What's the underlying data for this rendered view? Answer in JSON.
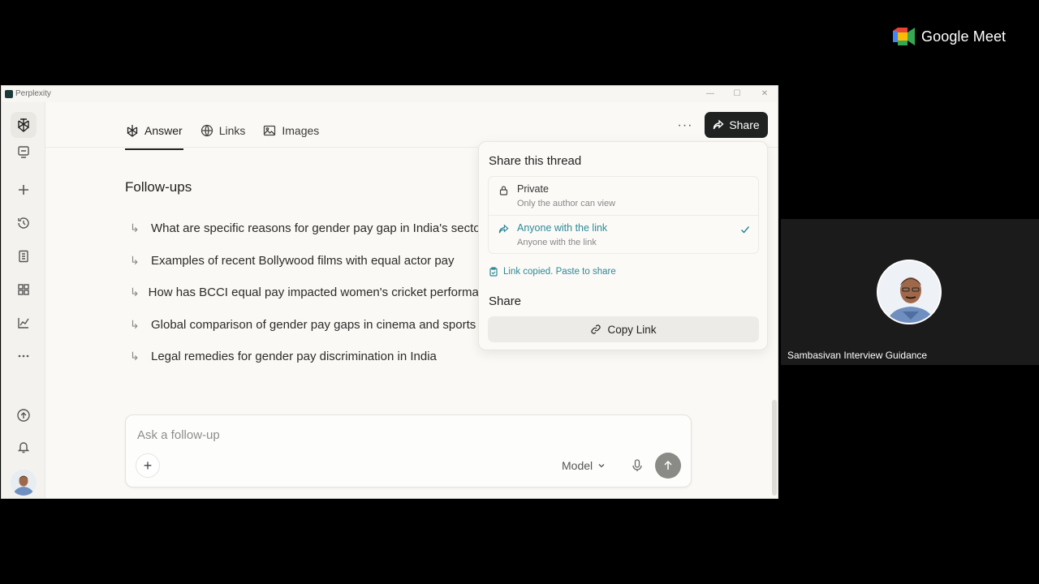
{
  "meet": {
    "brand": "Google Meet",
    "participant_name": "Sambasivan Interview Guidance",
    "colors": {
      "tile_bg": "#1b1b1b",
      "text": "#ffffff"
    }
  },
  "window": {
    "title": "Perplexity",
    "controls": [
      "minimize-icon",
      "maximize-icon",
      "close-icon"
    ]
  },
  "sidebar": {
    "items": [
      {
        "name": "perplexity-logo-icon",
        "active": true
      },
      {
        "name": "spaces-icon"
      },
      {
        "name": "new-thread-icon"
      },
      {
        "name": "history-icon"
      },
      {
        "name": "library-icon"
      },
      {
        "name": "discover-icon"
      },
      {
        "name": "finance-icon"
      },
      {
        "name": "more-icon"
      },
      {
        "name": "upgrade-icon"
      },
      {
        "name": "bell-icon"
      }
    ]
  },
  "tabs": [
    {
      "label": "Answer",
      "icon": "answer-icon",
      "active": true
    },
    {
      "label": "Links",
      "icon": "globe-icon"
    },
    {
      "label": "Images",
      "icon": "image-icon"
    }
  ],
  "header": {
    "more": "···",
    "share_label": "Share"
  },
  "followups": {
    "title": "Follow-ups",
    "items": [
      "What are specific reasons for gender pay gap in India's sectors",
      "Examples of recent Bollywood films with equal actor pay",
      "How has BCCI equal pay impacted women's cricket performance",
      "Global comparison of gender pay gaps in cinema and sports",
      "Legal remedies for gender pay discrimination in India"
    ]
  },
  "composer": {
    "placeholder": "Ask a follow-up",
    "model_label": "Model",
    "plus": "+"
  },
  "share_popover": {
    "title": "Share this thread",
    "options": [
      {
        "label": "Private",
        "description": "Only the author can view",
        "icon": "lock-icon",
        "selected": false
      },
      {
        "label": "Anyone with the link",
        "description": "Anyone with the link",
        "icon": "share-arrow-icon",
        "selected": true
      }
    ],
    "copied_message": "Link copied. Paste to share",
    "share_heading": "Share",
    "copy_link_label": "Copy Link",
    "accent": "#2d8a97"
  }
}
